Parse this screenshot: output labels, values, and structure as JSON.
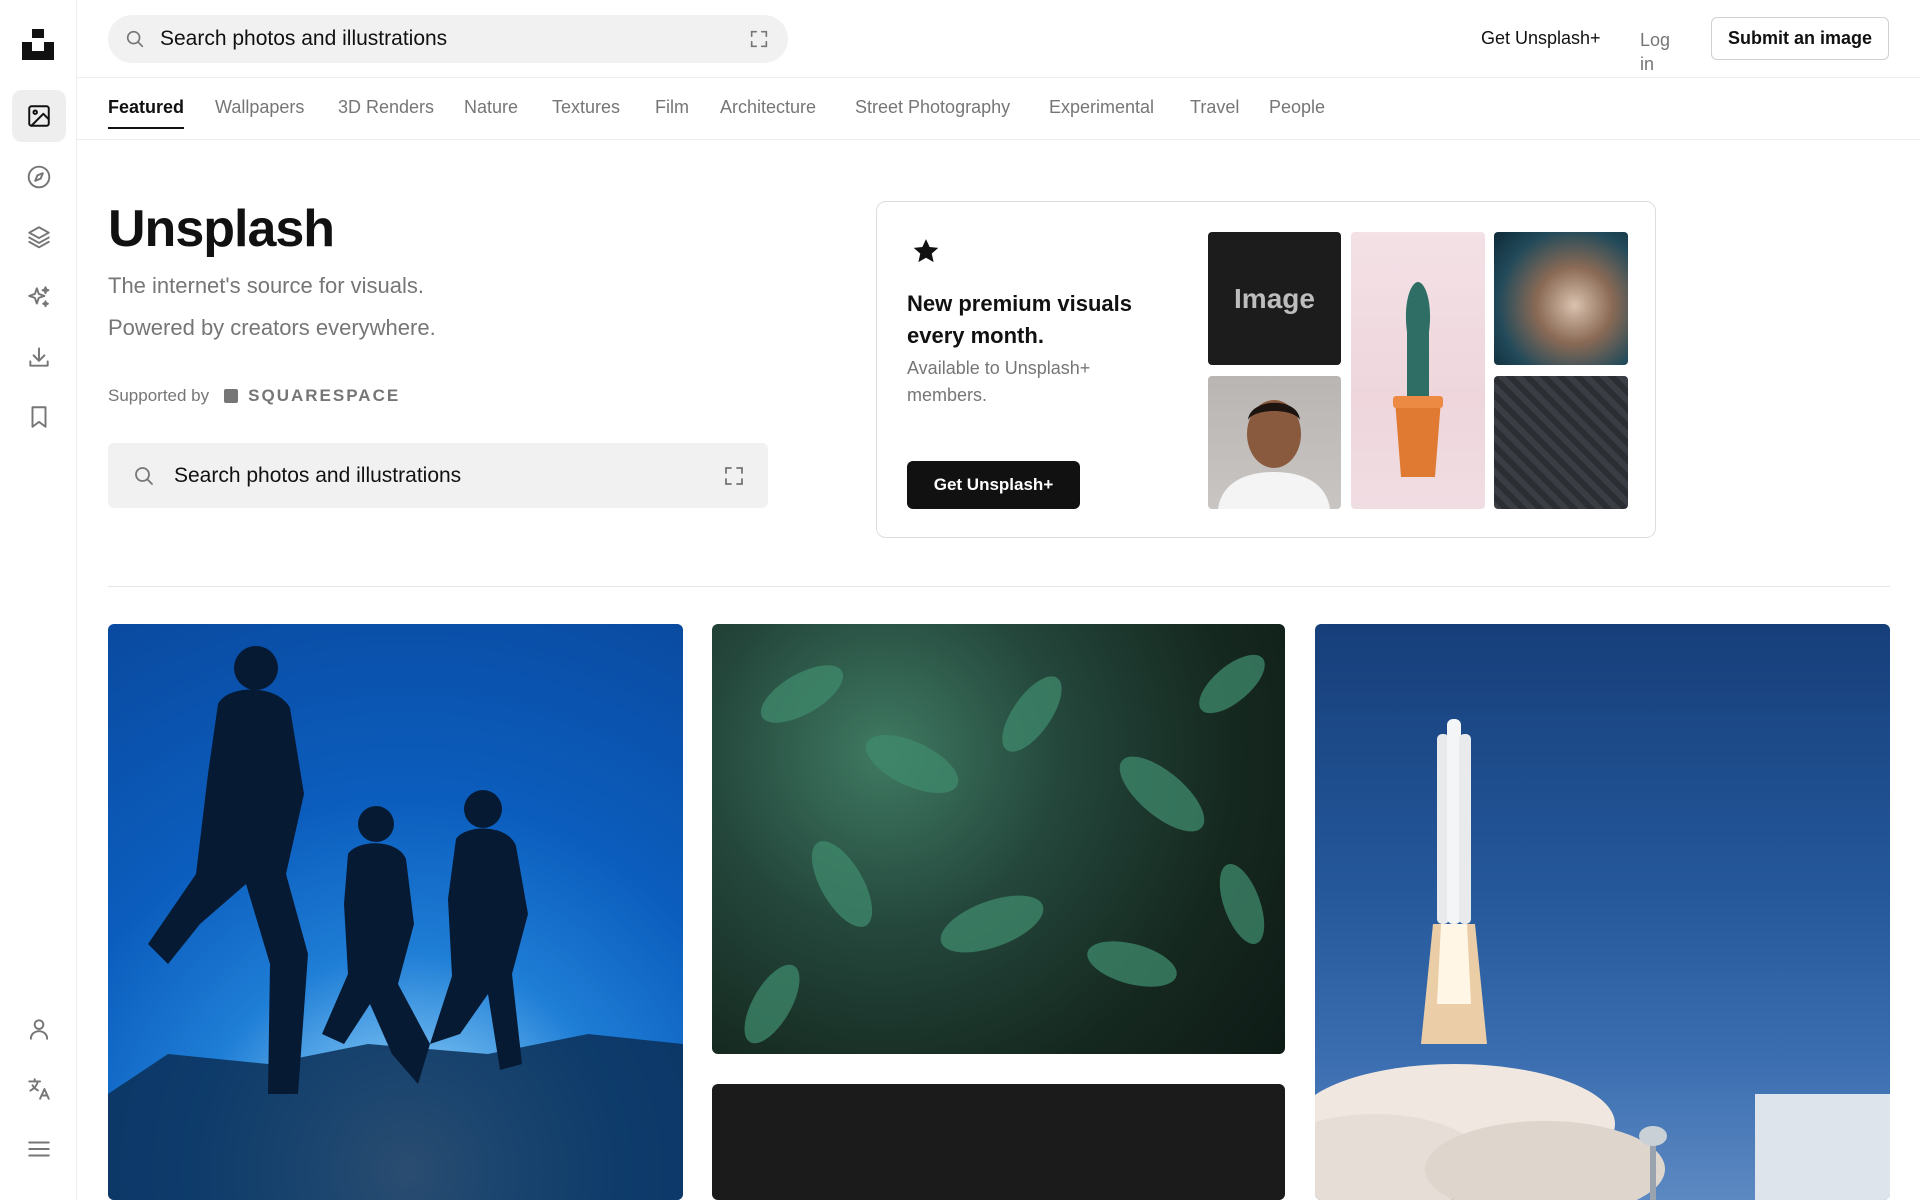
{
  "header": {
    "search_placeholder": "Search photos and illustrations",
    "get_plus": "Get Unsplash+",
    "login": "Log in",
    "submit": "Submit an image"
  },
  "sidebar": {
    "items": [
      {
        "icon": "image-icon",
        "active": true
      },
      {
        "icon": "compass-icon",
        "active": false
      },
      {
        "icon": "layers-icon",
        "active": false
      },
      {
        "icon": "sparkles-icon",
        "active": false
      },
      {
        "icon": "download-icon",
        "active": false
      },
      {
        "icon": "bookmark-icon",
        "active": false
      },
      {
        "icon": "user-icon",
        "active": false
      },
      {
        "icon": "translate-icon",
        "active": false
      },
      {
        "icon": "menu-icon",
        "active": false
      }
    ]
  },
  "tabs": [
    "Featured",
    "Wallpapers",
    "3D Renders",
    "Nature",
    "Textures",
    "Film",
    "Architecture",
    "Street Photography",
    "Experimental",
    "Travel",
    "People"
  ],
  "hero": {
    "title": "Unsplash",
    "subtitle_line1": "The internet's source for visuals.",
    "subtitle_line2": "Powered by creators everywhere.",
    "supported_by": "Supported by",
    "sponsor": "SQUARESPACE",
    "search_placeholder": "Search photos and illustrations"
  },
  "promo": {
    "title": "New premium visuals every month.",
    "subtitle": "Available to Unsplash+ members.",
    "button": "Get Unsplash+",
    "image_tile_label": "Image"
  },
  "colors": {
    "text": "#111111",
    "muted": "#767676",
    "search_bg": "#f1f1f1",
    "border": "#eeeeee"
  }
}
